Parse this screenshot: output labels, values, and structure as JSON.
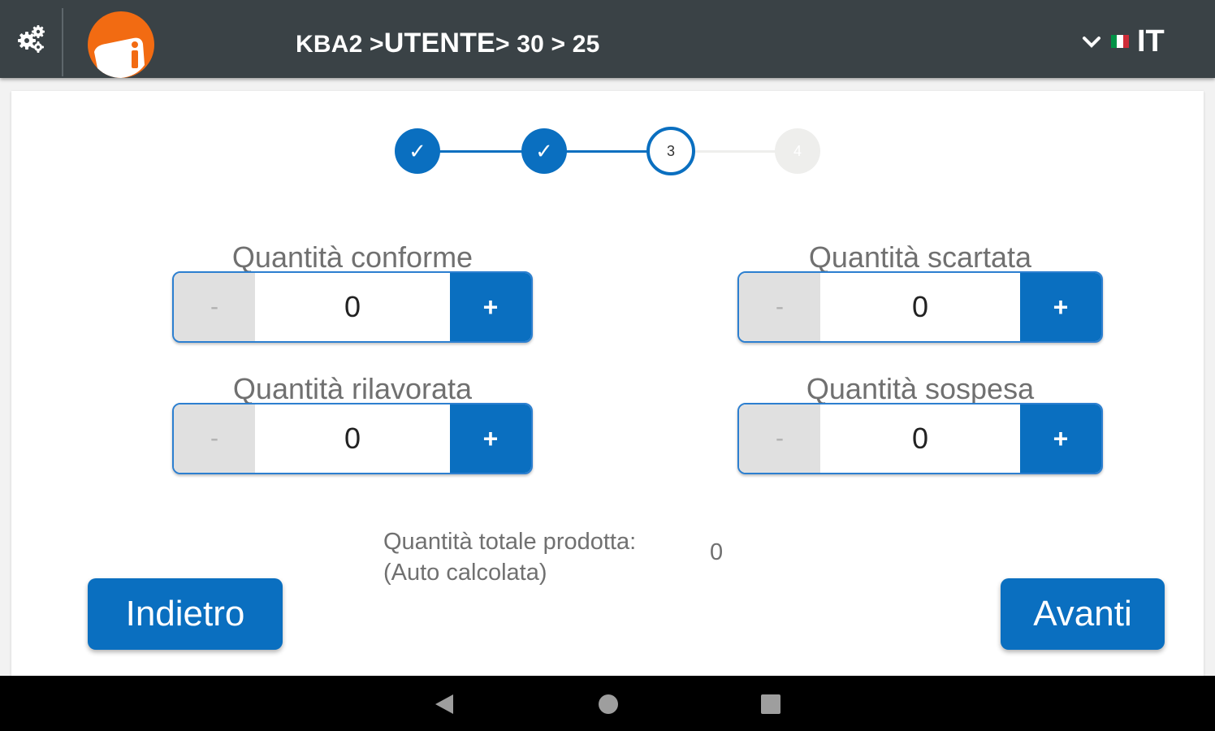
{
  "header": {
    "breadcrumb": [
      "KBA2 >",
      "UTENTE",
      "> 30 > 25"
    ],
    "language": "IT",
    "flag_colors": [
      "#009246",
      "#ffffff",
      "#ce2b37"
    ]
  },
  "stepper": {
    "steps": [
      {
        "label": "✓",
        "state": "done"
      },
      {
        "label": "✓",
        "state": "done"
      },
      {
        "label": "3",
        "state": "active"
      },
      {
        "label": "4",
        "state": "todo"
      }
    ]
  },
  "fields": [
    {
      "label": "Quantità conforme",
      "value": "0",
      "minus": "-",
      "plus": "+"
    },
    {
      "label": "Quantità scartata",
      "value": "0",
      "minus": "-",
      "plus": "+"
    },
    {
      "label": "Quantità rilavorata",
      "value": "0",
      "minus": "-",
      "plus": "+"
    },
    {
      "label": "Quantità sospesa",
      "value": "0",
      "minus": "-",
      "plus": "+"
    }
  ],
  "total": {
    "label_line1": "Quantità totale prodotta:",
    "label_line2": "(Auto calcolata)",
    "value": "0"
  },
  "buttons": {
    "back": "Indietro",
    "next": "Avanti"
  },
  "colors": {
    "primary": "#0a6fc0",
    "topbar": "#3a4246",
    "logo": "#f26b12"
  }
}
